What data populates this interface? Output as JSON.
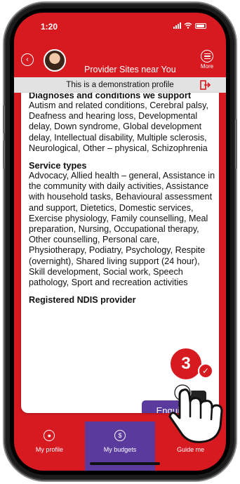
{
  "status": {
    "time": "1:20"
  },
  "header": {
    "title": "Provider Sites near You",
    "more_label": "More"
  },
  "demo_banner": "This is a demonstration profile",
  "details": {
    "diagnoses_heading": "Diagnoses and conditions we support",
    "diagnoses_text": "Autism and related conditions, Cerebral palsy, Deafness and hearing loss, Developmental delay, Down syndrome, Global development delay, Intellectual disability, Multiple sclerosis, Neurological, Other – physical, Schizophrenia",
    "service_heading": "Service types",
    "service_text": "Advocacy, Allied health – general, Assistance in the community with daily activities, Assistance with household tasks, Behavioural assessment and support, Dietetics, Domestic services, Exercise physiology, Family counselling, Meal preparation, Nursing, Occupational therapy, Other counselling, Personal care, Physiotherapy, Podiatry, Psychology, Respite (overnight), Shared living support (24 hour), Skill development, Social work, Speech pathology, Sport and recreation activities",
    "registered_label": "Registered NDIS provider"
  },
  "enquire_label": "Enquire",
  "step_number": "3",
  "nav": [
    {
      "label": "My profile",
      "icon": "person-icon"
    },
    {
      "label": "My budgets",
      "icon": "dollar-icon"
    },
    {
      "label": "Guide me",
      "icon": "guide-icon"
    }
  ],
  "colors": {
    "brand_red": "#d71920",
    "purple": "#5b3a9e",
    "banner_gray": "#e2e2e2"
  }
}
